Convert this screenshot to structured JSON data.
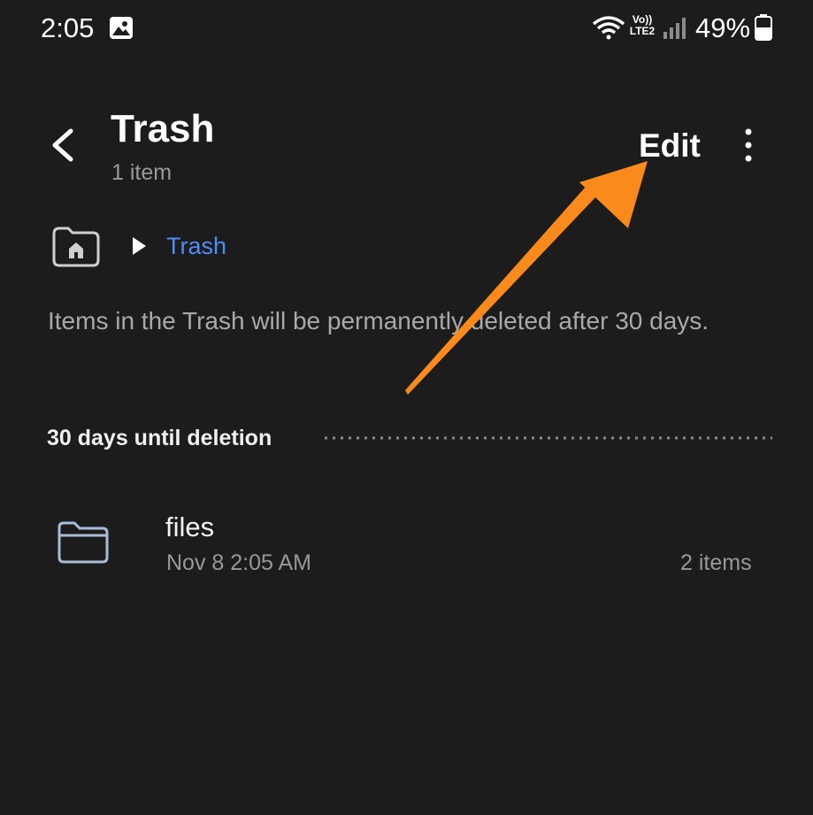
{
  "status_bar": {
    "time": "2:05",
    "volte_label": "Vo)) LTE2",
    "battery": "49%",
    "icons": [
      "gallery-icon",
      "wifi-icon",
      "signal-icon",
      "battery-icon"
    ]
  },
  "header": {
    "title": "Trash",
    "subtitle": "1 item",
    "edit_label": "Edit"
  },
  "breadcrumb": {
    "current": "Trash"
  },
  "info_text": "Items in the Trash will be permanently deleted after 30 days.",
  "section": {
    "label": "30 days until deletion"
  },
  "items": [
    {
      "name": "files",
      "date": "Nov 8 2:05 AM",
      "count": "2 items"
    }
  ],
  "colors": {
    "background": "#1c1c1d",
    "link_blue": "#4c8ef4",
    "annotation_orange": "#f98a1b"
  }
}
